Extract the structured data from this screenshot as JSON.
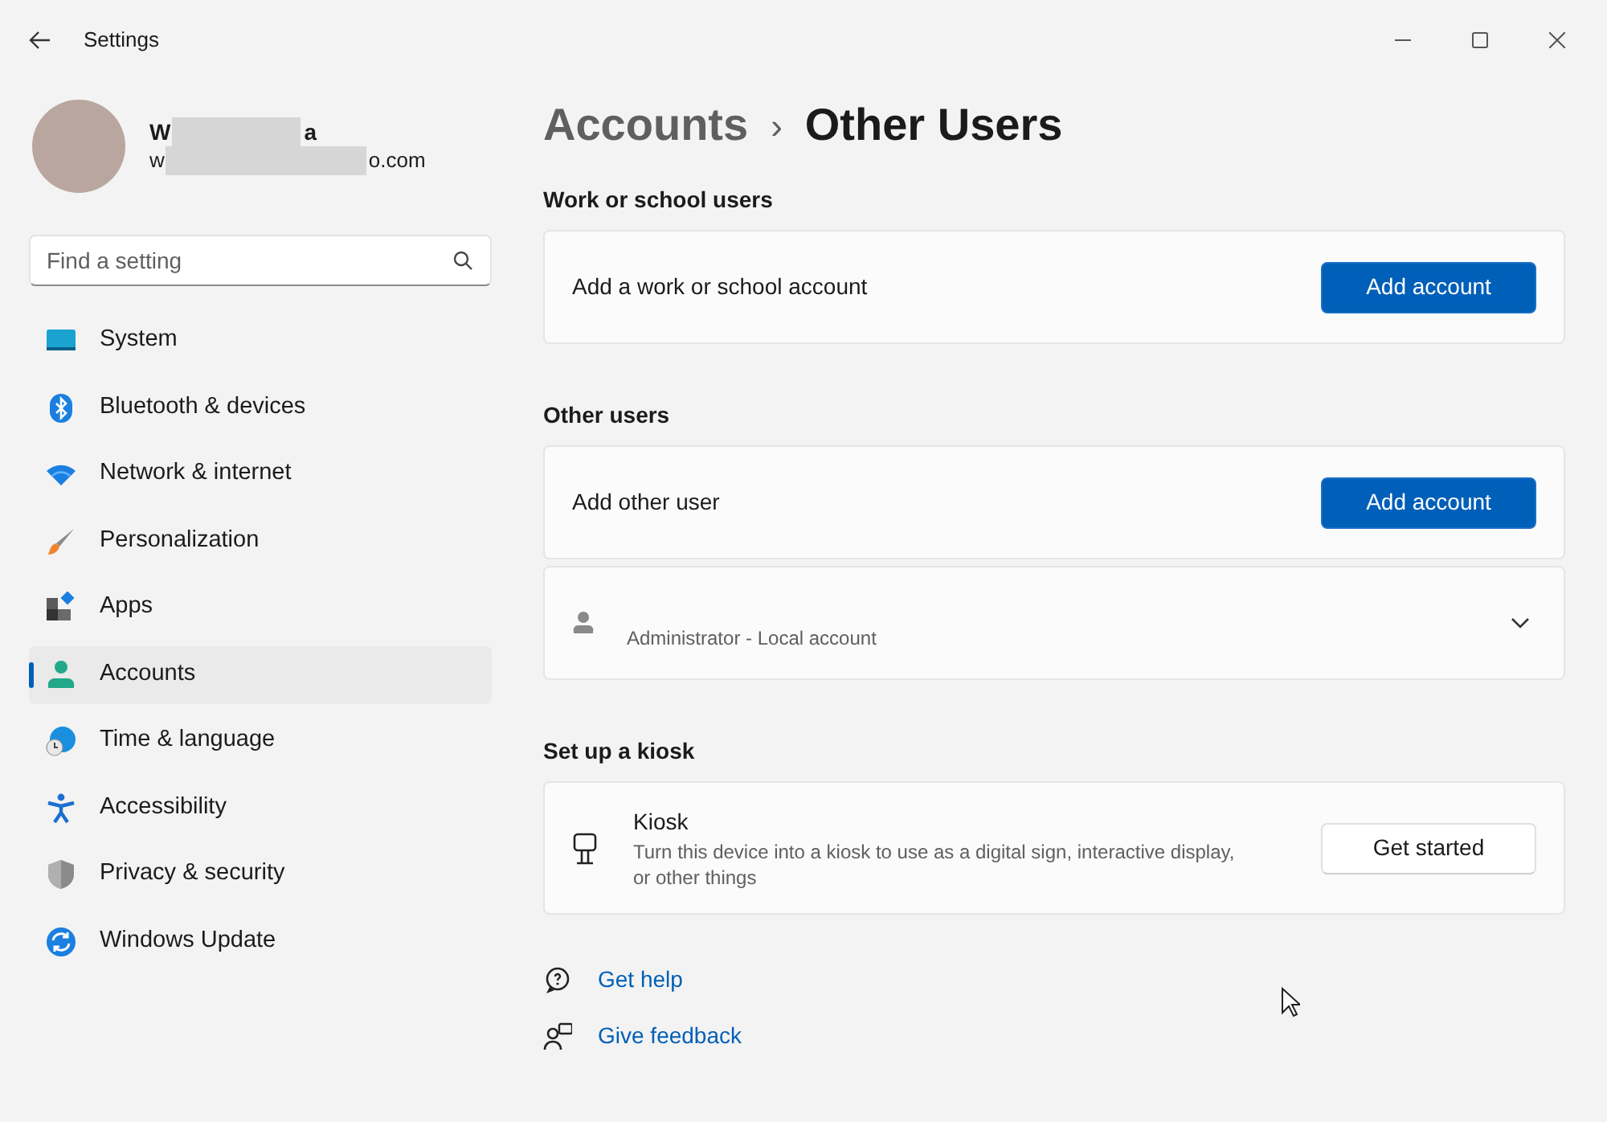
{
  "window": {
    "title": "Settings"
  },
  "profile": {
    "name_start": "W",
    "name_end": "a",
    "email_start": "w",
    "email_end": "o.com"
  },
  "search": {
    "placeholder": "Find a setting"
  },
  "sidebar": {
    "items": [
      {
        "label": "System",
        "kind": "system",
        "selected": false
      },
      {
        "label": "Bluetooth & devices",
        "kind": "bluetooth",
        "selected": false
      },
      {
        "label": "Network & internet",
        "kind": "wifi",
        "selected": false
      },
      {
        "label": "Personalization",
        "kind": "brush",
        "selected": false
      },
      {
        "label": "Apps",
        "kind": "apps",
        "selected": false
      },
      {
        "label": "Accounts",
        "kind": "accounts",
        "selected": true
      },
      {
        "label": "Time & language",
        "kind": "time",
        "selected": false
      },
      {
        "label": "Accessibility",
        "kind": "accessibility",
        "selected": false
      },
      {
        "label": "Privacy & security",
        "kind": "shield",
        "selected": false
      },
      {
        "label": "Windows Update",
        "kind": "update",
        "selected": false
      }
    ]
  },
  "breadcrumb": {
    "parent": "Accounts",
    "separator": "›",
    "current": "Other Users"
  },
  "sections": [
    {
      "title": "Work or school users",
      "cards": [
        {
          "kind": "action",
          "label": "Add a work or school account",
          "button": "Add account"
        }
      ]
    },
    {
      "title": "Other users",
      "cards": [
        {
          "kind": "action",
          "label": "Add other user",
          "button": "Add account"
        },
        {
          "kind": "user",
          "subtitle": "Administrator - Local account",
          "expanded": false
        }
      ]
    },
    {
      "title": "Set up a kiosk",
      "cards": [
        {
          "kind": "kiosk",
          "label": "Kiosk",
          "description": "Turn this device into a kiosk to use as a digital sign, interactive display, or other things",
          "button": "Get started"
        }
      ]
    }
  ],
  "links": [
    {
      "kind": "help",
      "label": "Get help"
    },
    {
      "kind": "feedback",
      "label": "Give feedback"
    }
  ]
}
